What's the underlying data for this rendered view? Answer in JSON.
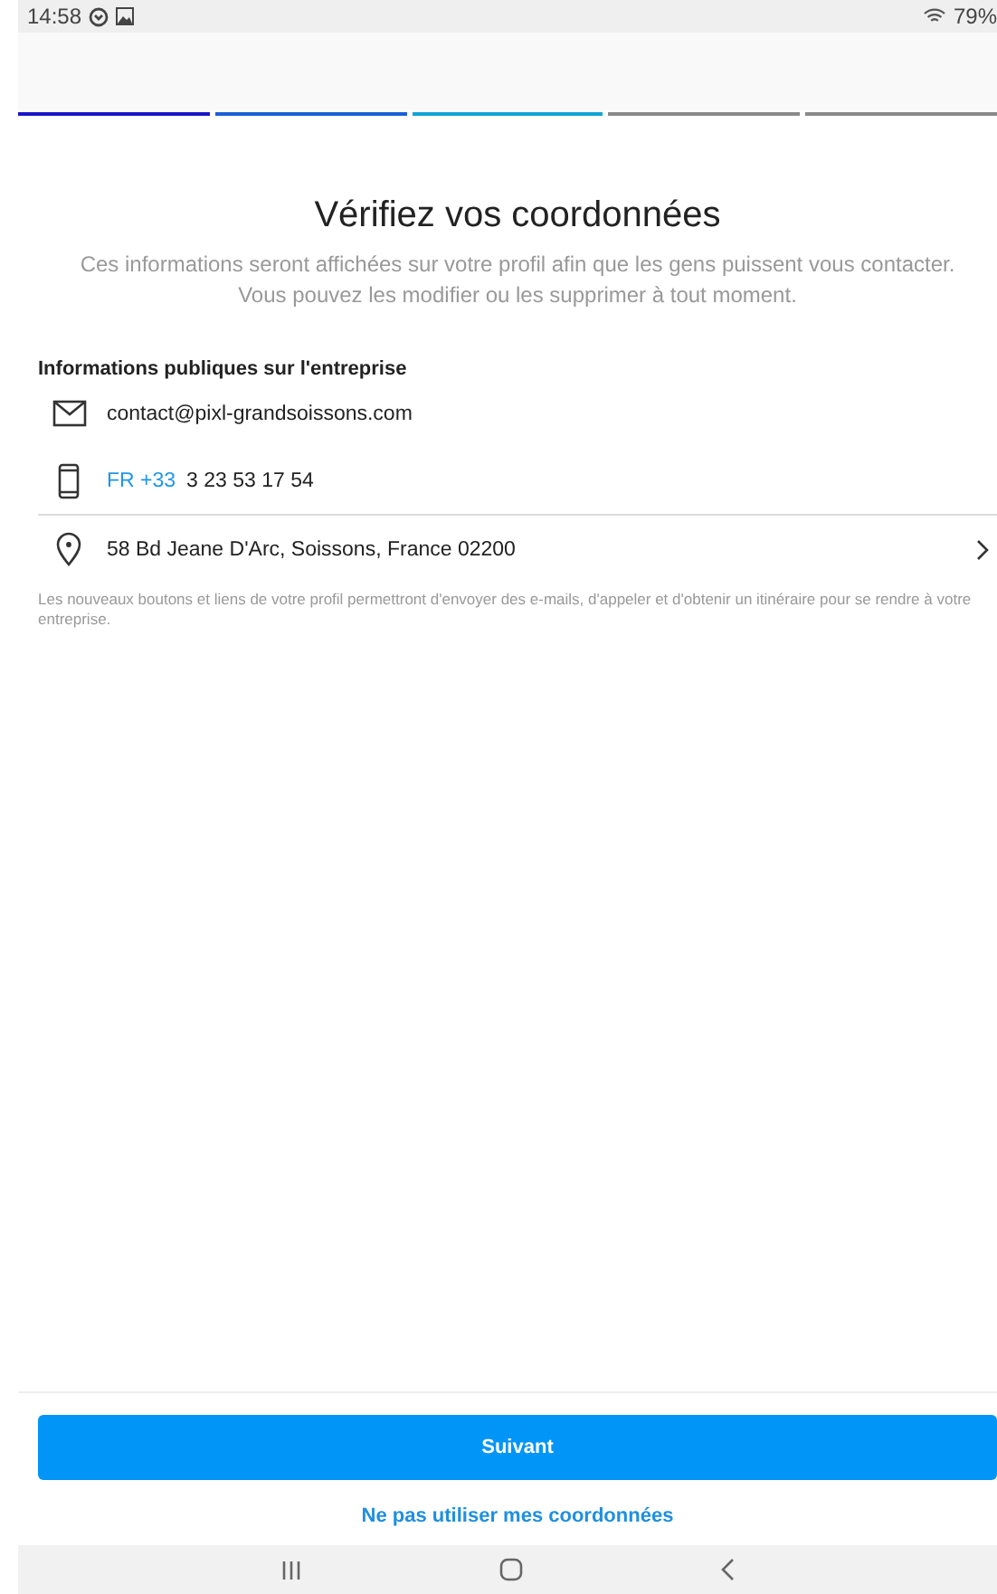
{
  "status_bar": {
    "time": "14:58",
    "battery": "79%"
  },
  "progress": [
    {
      "color": "#1a16c8"
    },
    {
      "color": "#1c5fd6"
    },
    {
      "color": "#12a4d6"
    },
    {
      "color": "#8a8a8a"
    },
    {
      "color": "#8a8a8a"
    }
  ],
  "title": "Vérifiez vos coordonnées",
  "subtitle": "Ces informations seront affichées sur votre profil afin que les gens puissent vous contacter. Vous pouvez les modifier ou les supprimer à tout moment.",
  "section_heading": "Informations publiques sur l'entreprise",
  "contacts": [
    {
      "kind": "email",
      "value": "contact@pixl-grandsoissons.com"
    },
    {
      "kind": "phone",
      "prefix": "FR +33",
      "value": "3 23 53 17 54"
    },
    {
      "kind": "address",
      "value": "58 Bd Jeane D'Arc, Soissons, France 02200"
    }
  ],
  "note": "Les nouveaux boutons et liens de votre profil permettront d'envoyer des e-mails, d'appeler et d'obtenir un itinéraire pour se rendre à votre entreprise.",
  "primary_button": "Suivant",
  "secondary_link": "Ne pas utiliser mes coordonnées"
}
